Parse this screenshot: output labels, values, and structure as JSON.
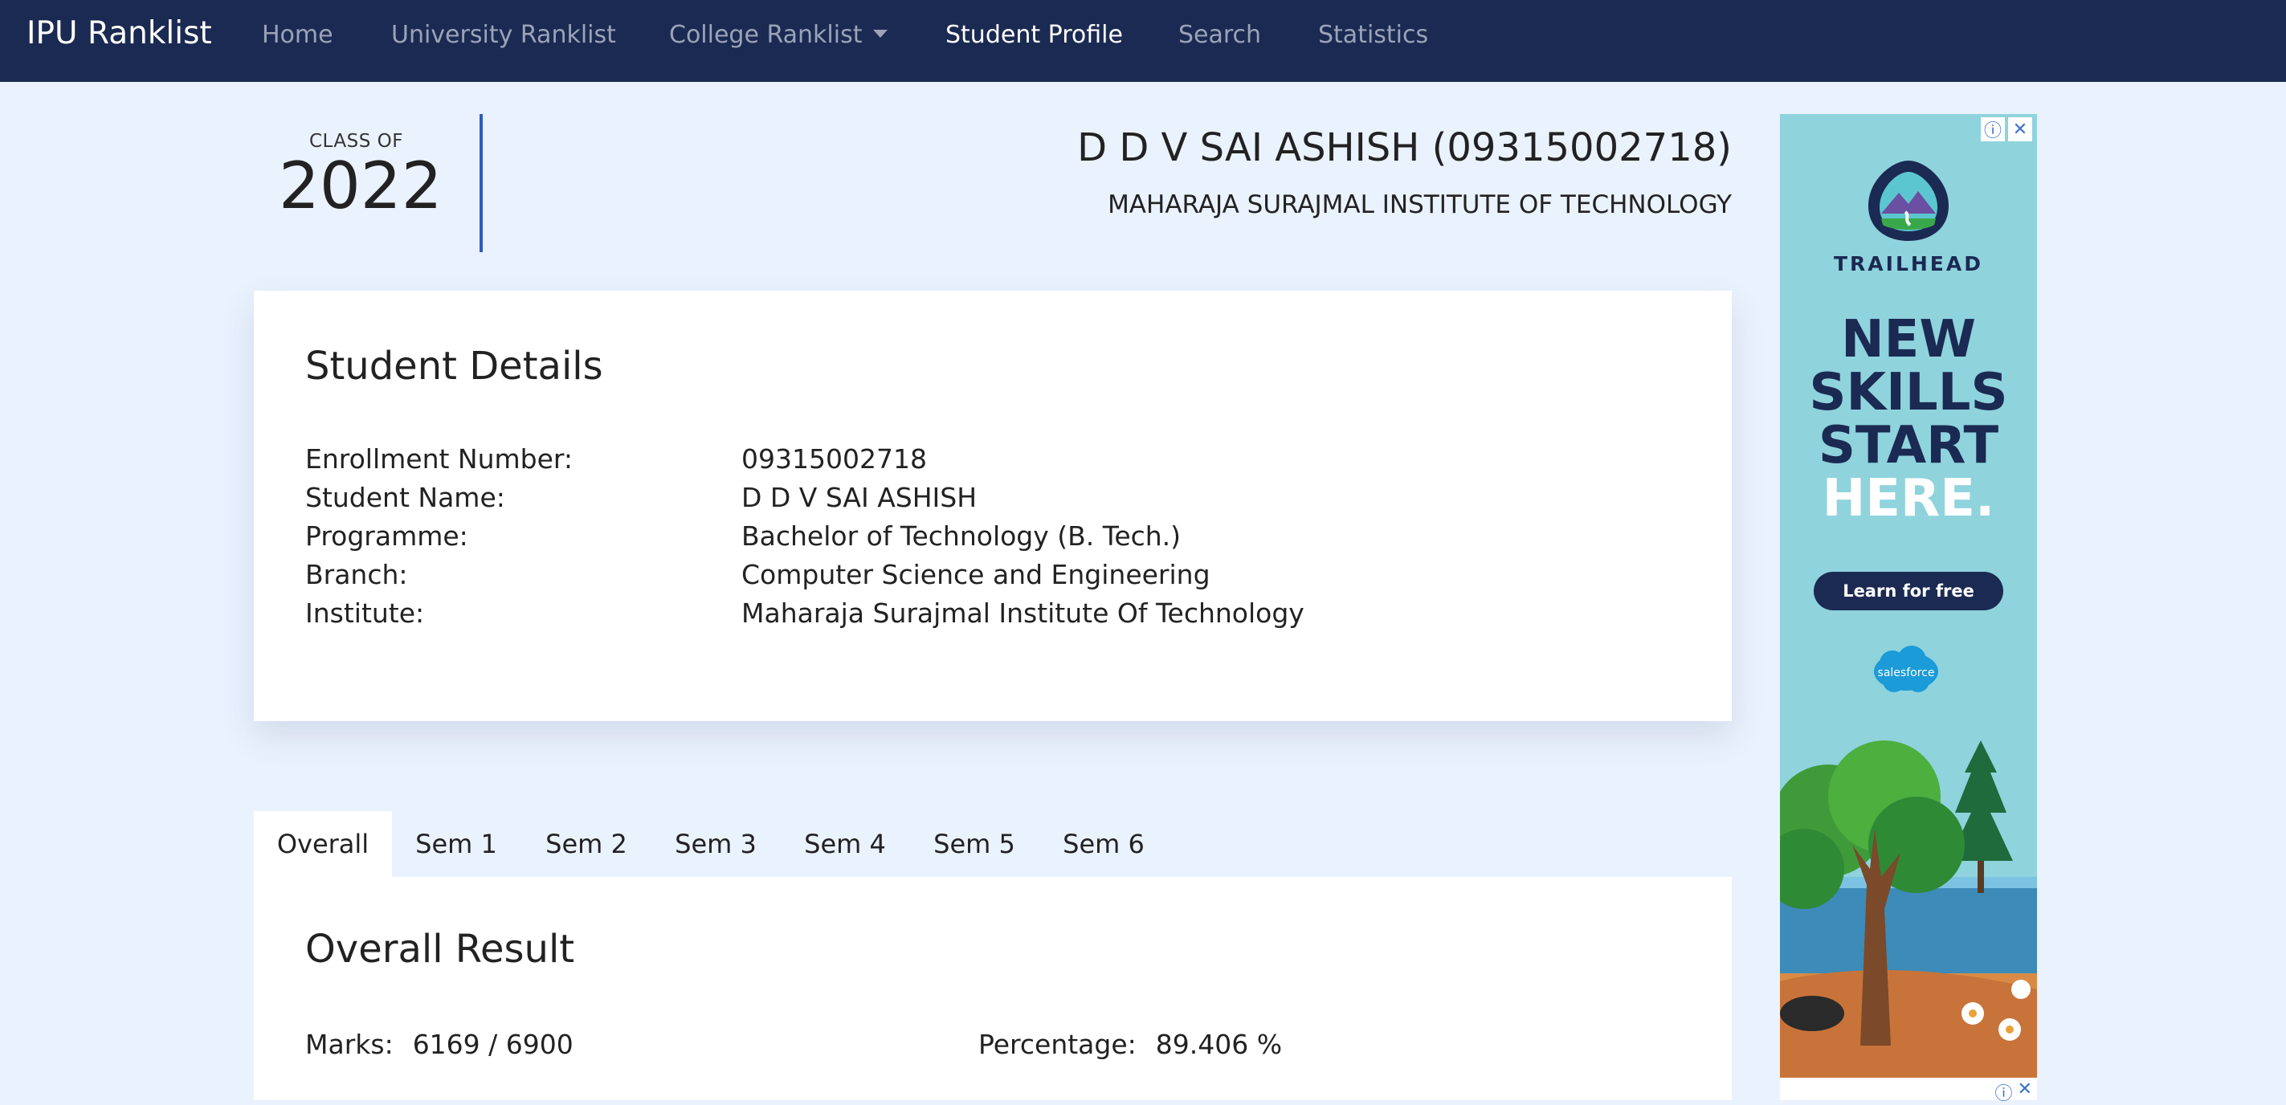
{
  "navbar": {
    "brand": "IPU Ranklist",
    "items": [
      {
        "label": "Home"
      },
      {
        "label": "University Ranklist"
      },
      {
        "label": "College Ranklist"
      },
      {
        "label": "Student Profile"
      },
      {
        "label": "Search"
      },
      {
        "label": "Statistics"
      }
    ],
    "active": "Student Profile"
  },
  "header": {
    "class_of_label": "CLASS OF",
    "class_year": "2022",
    "student_title": "D D V SAI ASHISH (09315002718)",
    "institute": "MAHARAJA SURAJMAL INSTITUTE OF TECHNOLOGY"
  },
  "details": {
    "title": "Student Details",
    "rows": [
      {
        "label": "Enrollment Number:",
        "value": "09315002718"
      },
      {
        "label": "Student Name:",
        "value": "D D V SAI ASHISH"
      },
      {
        "label": "Programme:",
        "value": "Bachelor of Technology (B. Tech.)"
      },
      {
        "label": "Branch:",
        "value": "Computer Science and Engineering"
      },
      {
        "label": "Institute:",
        "value": "Maharaja Surajmal Institute Of Technology"
      }
    ]
  },
  "tabs": [
    {
      "label": "Overall"
    },
    {
      "label": "Sem 1"
    },
    {
      "label": "Sem 2"
    },
    {
      "label": "Sem 3"
    },
    {
      "label": "Sem 4"
    },
    {
      "label": "Sem 5"
    },
    {
      "label": "Sem 6"
    }
  ],
  "result": {
    "title": "Overall Result",
    "marks_label": "Marks:",
    "marks_value": "6169 / 6900",
    "percentage_label": "Percentage:",
    "percentage_value": "89.406 %"
  },
  "ad": {
    "brand": "TRAILHEAD",
    "headline_1": "NEW",
    "headline_2": "SKILLS",
    "headline_3": "START",
    "headline_4": "HERE.",
    "cta": "Learn for free",
    "sponsor": "salesforce",
    "info_icon": "ⓘ",
    "close_icon": "✕"
  },
  "colors": {
    "navbar_bg": "#1b2a52",
    "page_bg": "#eaf2fd",
    "accent_divider": "#2f5bbd",
    "ad_bg": "#8fd3dd"
  }
}
